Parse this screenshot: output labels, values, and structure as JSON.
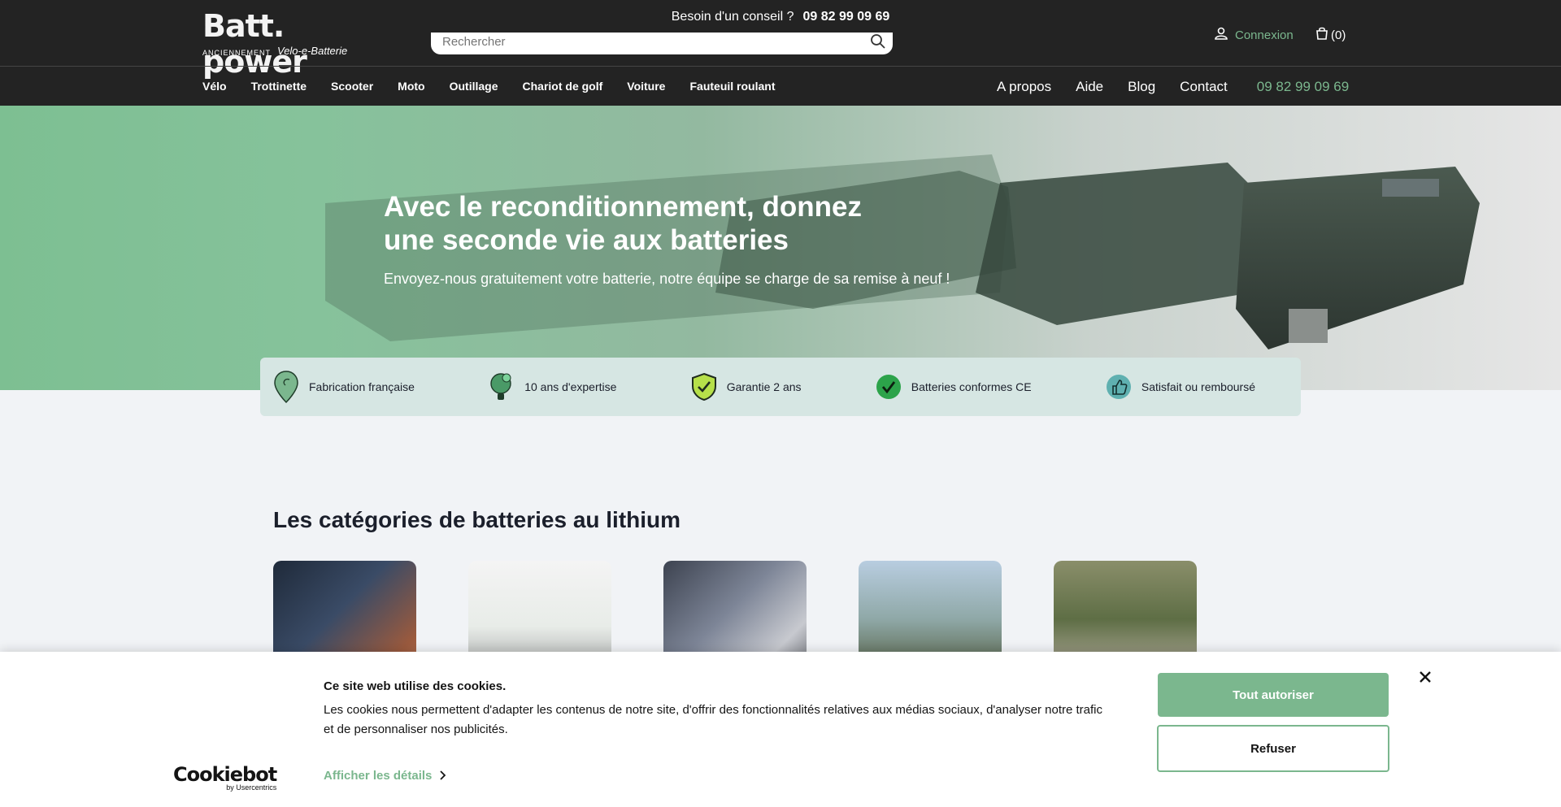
{
  "topbar": {
    "advice_label": "Besoin d'un conseil ?",
    "phone": "09 82 99 09 69"
  },
  "logo": {
    "brand": "Batt. power",
    "formerly": "ANCIENNEMENT",
    "old_brand": "Velo-e-Batterie"
  },
  "search": {
    "placeholder": "Rechercher",
    "icon": "search-icon"
  },
  "account": {
    "label": "Connexion",
    "icon": "user-icon"
  },
  "cart": {
    "label": "(0)",
    "icon": "cart-icon"
  },
  "nav": {
    "items": [
      "Vélo",
      "Trottinette",
      "Scooter",
      "Moto",
      "Outillage",
      "Chariot de golf",
      "Voiture",
      "Fauteuil roulant"
    ],
    "right": [
      "A propos",
      "Aide",
      "Blog",
      "Contact"
    ],
    "phone": "09 82 99 09 69"
  },
  "hero": {
    "title_line1": "Avec le reconditionnement, donnez",
    "title_line2": "une seconde vie aux batteries",
    "subtitle": "Envoyez-nous gratuitement votre batterie, notre équipe se charge de sa remise à neuf !"
  },
  "features": [
    {
      "label": "Fabrication française",
      "icon": "location-pin-icon"
    },
    {
      "label": "10 ans d'expertise",
      "icon": "lightbulb-icon"
    },
    {
      "label": "Garantie 2 ans",
      "icon": "shield-check-icon"
    },
    {
      "label": "Batteries conformes CE",
      "icon": "check-circle-icon"
    },
    {
      "label": "Satisfait ou remboursé",
      "icon": "thumbs-up-icon"
    }
  ],
  "categories": {
    "title": "Les catégories de batteries au lithium"
  },
  "cookie": {
    "title": "Ce site web utilise des cookies.",
    "text": "Les cookies nous permettent d'adapter les contenus de notre site, d'offrir des fonctionnalités relatives aux médias sociaux, d'analyser notre trafic et de personnaliser nos publicités.",
    "details": "Afficher les détails",
    "accept": "Tout autoriser",
    "refuse": "Refuser",
    "provider": "Cookiebot",
    "provider_sub": "by Usercentrics"
  },
  "colors": {
    "header_bg": "#232323",
    "accent_green": "#7bb78e",
    "features_bg": "#d6e6e3"
  }
}
